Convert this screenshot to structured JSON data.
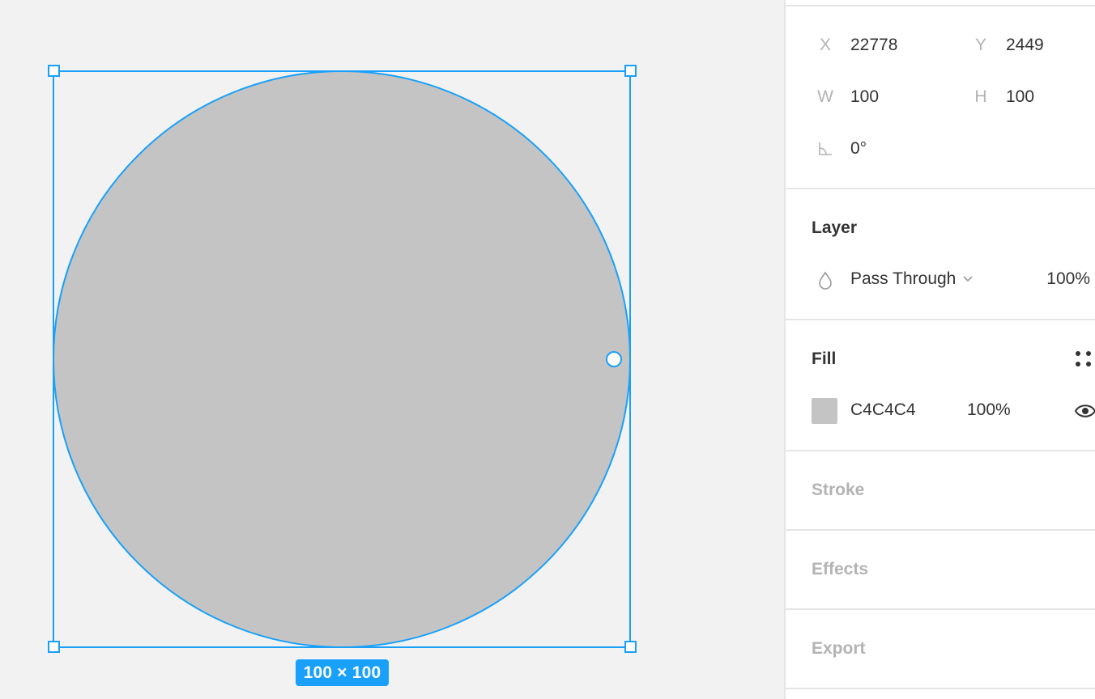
{
  "canvas": {
    "selection": {
      "size_label": "100 × 100"
    },
    "shape": {
      "type": "ellipse",
      "fill": "#C4C4C4",
      "selection_color": "#18A0FB"
    }
  },
  "panel": {
    "geometry": {
      "x_label": "X",
      "x_value": "22778",
      "y_label": "Y",
      "y_value": "2449",
      "w_label": "W",
      "w_value": "100",
      "h_label": "H",
      "h_value": "100",
      "rotation_value": "0°"
    },
    "layer": {
      "title": "Layer",
      "blend_mode": "Pass Through",
      "opacity": "100%"
    },
    "fill": {
      "title": "Fill",
      "color_hex": "C4C4C4",
      "swatch_color": "#C4C4C4",
      "opacity": "100%"
    },
    "stroke": {
      "title": "Stroke"
    },
    "effects": {
      "title": "Effects"
    },
    "export": {
      "title": "Export"
    }
  }
}
